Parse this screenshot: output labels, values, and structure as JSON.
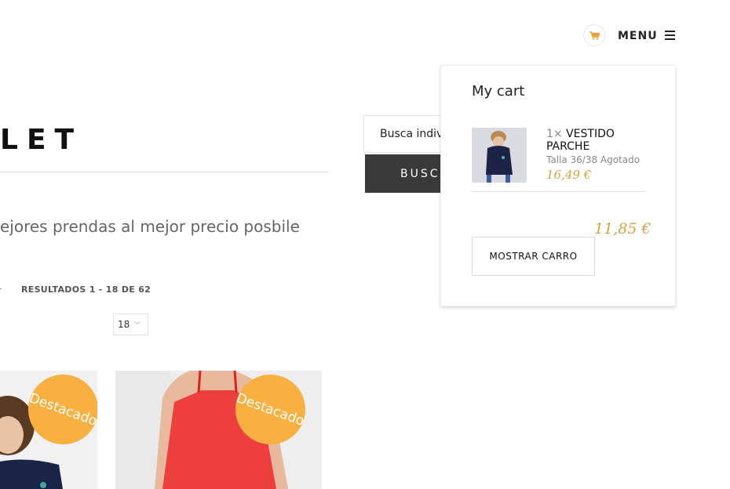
{
  "header": {
    "cart_icon": "shopping-cart-icon",
    "menu_label": "MENU",
    "menu_icon": "hamburger-icon"
  },
  "page": {
    "title": "LET",
    "subtitle": "ejores prendas al mejor precio posbile"
  },
  "search": {
    "input_value": "Busca indiv",
    "button_label": "BUSCA"
  },
  "results": {
    "count_text": "RESULTADOS 1 - 18 DE 62",
    "per_page_value": "18"
  },
  "products": [
    {
      "badge": "Destacado"
    },
    {
      "badge": "Destacado"
    }
  ],
  "cart": {
    "title": "My cart",
    "items": [
      {
        "qty": "1×",
        "name": "VESTIDO PARCHE",
        "variant": "Talla 36/38 Agotado",
        "price": "16,49 €"
      }
    ],
    "total": "11,85 €",
    "show_cart_label": "MOSTRAR CARRO"
  },
  "colors": {
    "accent": "#dba141",
    "badge": "#f8b040",
    "search_button": "#3a3a3a"
  }
}
